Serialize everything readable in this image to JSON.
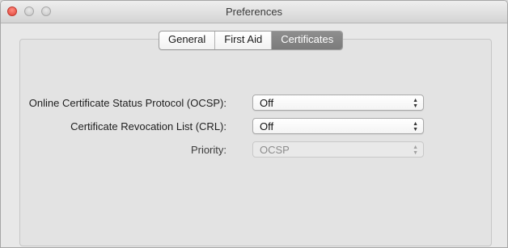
{
  "window": {
    "title": "Preferences"
  },
  "tabs": [
    {
      "label": "General",
      "active": false
    },
    {
      "label": "First Aid",
      "active": false
    },
    {
      "label": "Certificates",
      "active": true
    }
  ],
  "settings": {
    "ocsp": {
      "label": "Online Certificate Status Protocol (OCSP):",
      "value": "Off",
      "enabled": true
    },
    "crl": {
      "label": "Certificate Revocation List (CRL):",
      "value": "Off",
      "enabled": true
    },
    "priority": {
      "label": "Priority:",
      "value": "OCSP",
      "enabled": false
    }
  },
  "colors": {
    "close_button": "#e0443a",
    "active_tab": "#7f7f7f"
  }
}
